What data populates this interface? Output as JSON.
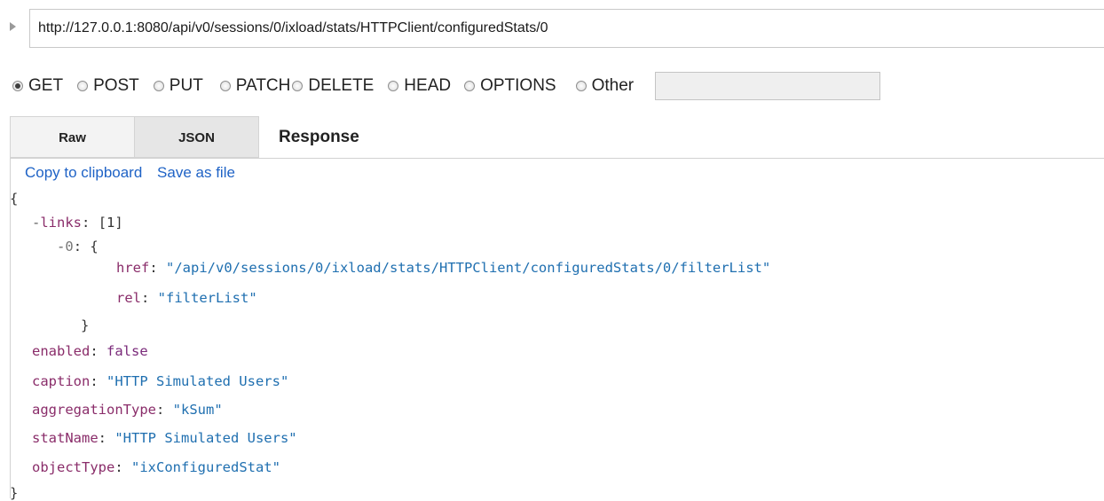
{
  "request": {
    "url": "http://127.0.0.1:8080/api/v0/sessions/0/ixload/stats/HTTPClient/configuredStats/0",
    "methods": [
      "GET",
      "POST",
      "PUT",
      "PATCH",
      "DELETE",
      "HEAD",
      "OPTIONS",
      "Other"
    ],
    "selected_method": "GET",
    "other_value": ""
  },
  "tabs": {
    "raw": "Raw",
    "json": "JSON",
    "active": "JSON",
    "response_label": "Response"
  },
  "actions": {
    "copy": "Copy to clipboard",
    "save": "Save as file"
  },
  "json_view": {
    "open_brace": "{",
    "close_brace": "}",
    "toggle": "-",
    "links_key": "links",
    "links_count": "[1]",
    "item_index": "0",
    "item_open": "{",
    "item_close": "}",
    "href_key": "href",
    "href_value": "\"/api/v0/sessions/0/ixload/stats/HTTPClient/configuredStats/0/filterList\"",
    "rel_key": "rel",
    "rel_value": "\"filterList\"",
    "enabled_key": "enabled",
    "enabled_value": "false",
    "caption_key": "caption",
    "caption_value": "\"HTTP Simulated Users\"",
    "aggregation_key": "aggregationType",
    "aggregation_value": "\"kSum\"",
    "statname_key": "statName",
    "statname_value": "\"HTTP Simulated Users\"",
    "objecttype_key": "objectType",
    "objecttype_value": "\"ixConfiguredStat\""
  }
}
